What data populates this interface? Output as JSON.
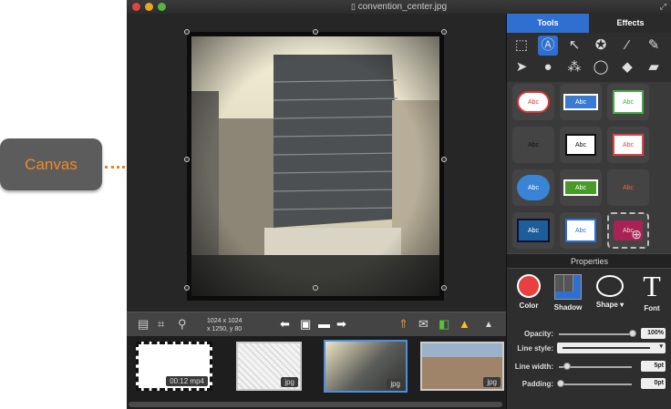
{
  "callout": {
    "label": "Canvas"
  },
  "window": {
    "title": "convention_center.jpg"
  },
  "info": {
    "size": "1024 x 1024",
    "coords": "x 1250,  y 80"
  },
  "filmstrip": [
    {
      "badge": "00:12 mp4"
    },
    {
      "badge": "jpg"
    },
    {
      "badge": "jpg"
    },
    {
      "badge": "jpg"
    }
  ],
  "panel": {
    "tabs": [
      "Tools",
      "Effects"
    ],
    "tools": [
      "select-rect-icon",
      "text-bubble-icon",
      "arrow-icon",
      "star-icon",
      "eyedropper-icon",
      "pencil-icon",
      "pointer-icon",
      "drop-icon",
      "circles-icon",
      "lasso-icon",
      "bucket-icon",
      "eraser-icon"
    ],
    "shapes": [
      "Abc",
      "Abc",
      "Abc",
      "Abc",
      "Abc",
      "Abc",
      "Abc",
      "Abc",
      "Abc",
      "Abc",
      "Abc",
      "Abc"
    ],
    "properties_title": "Properties",
    "props": {
      "color": "Color",
      "shadow": "Shadow",
      "shape": "Shape ▾",
      "font": "Font"
    },
    "opacity": {
      "label": "Opacity:",
      "value": "100%"
    },
    "line_style": {
      "label": "Line style:"
    },
    "line_width": {
      "label": "Line width:",
      "value": "5pt"
    },
    "padding": {
      "label": "Padding:",
      "value": "0pt"
    }
  },
  "colors": {
    "accent": "#2f6fd0",
    "orange": "#e8821e"
  }
}
